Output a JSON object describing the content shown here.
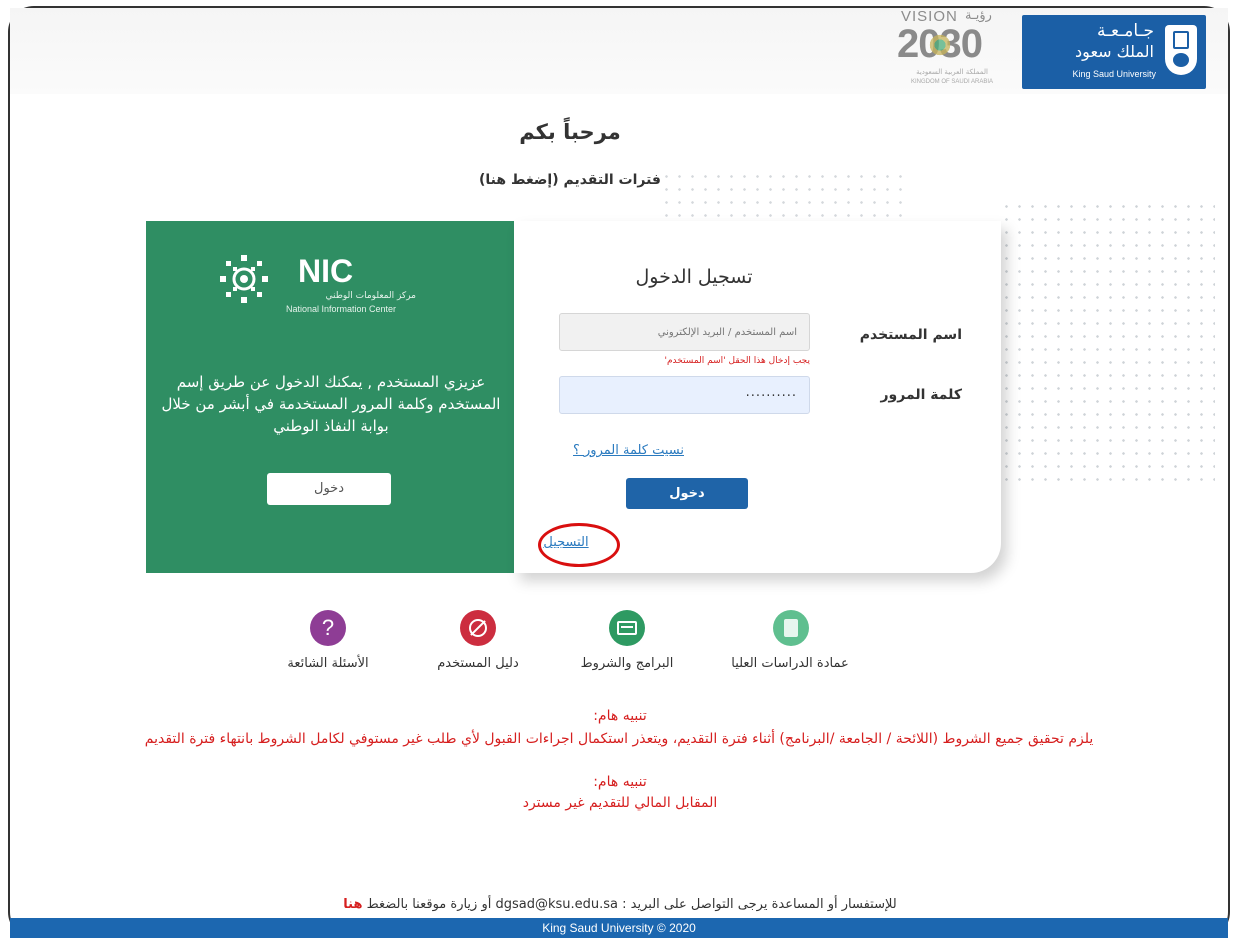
{
  "header": {
    "vision": {
      "title": "VISION",
      "year": "2030",
      "arabic": "رؤيـة",
      "sub_ar": "المملكة العربية السعودية",
      "sub_en": "KINGDOM OF SAUDI ARABIA"
    },
    "ksu": {
      "ar_line1": "جـامـعـة",
      "ar_line2": "الملك سعود",
      "en": "King Saud University"
    }
  },
  "welcome": {
    "title": "مرحباً بكم",
    "application_periods_link": "فترات التقديم (إضغط هنا)"
  },
  "nic_panel": {
    "logo_text": "NIC",
    "logo_ar": "مركز المعلومات الوطني",
    "logo_en": "National Information Center",
    "message": "عزيزي المستخدم , يمكنك الدخول عن طريق إسم المستخدم وكلمة المرور المستخدمة في أبشر من خلال بوابة النفاذ الوطني",
    "login_button": "دخول"
  },
  "login_form": {
    "title": "تسجيل الدخول",
    "username_label": "اسم المستخدم",
    "username_placeholder": "اسم المستخدم / البريد الإلكتروني",
    "username_error": "يجب إدخال هذا الحقل 'اسم المستخدم'",
    "password_label": "كلمة المرور",
    "password_value": "..........",
    "forgot_password": "نسيت كلمة المرور ؟",
    "login_button": "دخول",
    "register_link": "التسجيل"
  },
  "quick_links": [
    {
      "label": "عمادة الدراسات العليا",
      "icon": "document-icon",
      "color": "#5fbf8f"
    },
    {
      "label": "البرامج والشروط",
      "icon": "card-icon",
      "color": "#2e9a62"
    },
    {
      "label": "دليل المستخدم",
      "icon": "ban-icon",
      "color": "#cc2d3f"
    },
    {
      "label": "الأسئلة الشائعة",
      "icon": "question-icon",
      "color": "#8e3d95"
    }
  ],
  "notices": {
    "notice1_title": "تنبيه هام:",
    "notice1_text": "يلزم تحقيق جميع الشروط (اللائحة / الجامعة /البرنامج) أثناء فترة التقديم، ويتعذر استكمال اجراءات القبول لأي طلب غير مستوفي لكامل الشروط بانتهاء فترة التقديم",
    "notice2_title": "تنبيه هام:",
    "notice2_text": "المقابل المالي للتقديم غير مسترد"
  },
  "footer": {
    "contact_prefix": "للإستفسار أو المساعدة يرجى التواصل على البريد : dgsad@ksu.edu.sa أو زيارة موقعنا بالضغط",
    "contact_link": "هنا",
    "copyright": "King Saud University © 2020"
  },
  "colors": {
    "green_panel": "#2f8e63",
    "primary_blue": "#1f64a8",
    "notice_red": "#d61f1f",
    "highlight_circle": "#d90f0f"
  }
}
